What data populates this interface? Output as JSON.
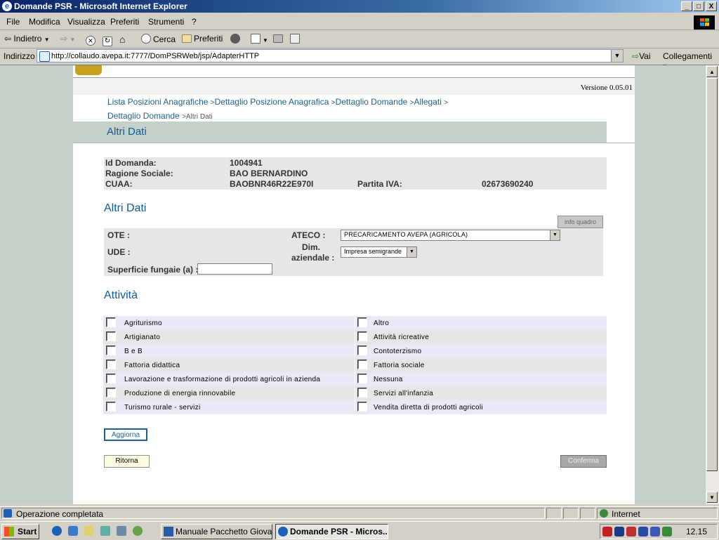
{
  "window": {
    "title": "Domande PSR - Microsoft Internet Explorer",
    "minimize_label": "_",
    "maximize_label": "□",
    "close_label": "X"
  },
  "menu": [
    "File",
    "Modifica",
    "Visualizza",
    "Preferiti",
    "Strumenti",
    "?"
  ],
  "toolbar": {
    "back_label": "Indietro",
    "search_label": "Cerca",
    "favorites_label": "Preferiti"
  },
  "address": {
    "label": "Indirizzo",
    "url": "http://collaudo.avepa.it:7777/DomPSRWeb/jsp/AdapterHTTP",
    "go_label": "Vai",
    "links_label": "Collegamenti"
  },
  "page": {
    "version": "Versione 0.05.01",
    "breadcrumb": [
      {
        "label": "Lista Posizioni Anagrafiche",
        "link": true
      },
      {
        "label": "Dettaglio Posizione Anagrafica",
        "link": true
      },
      {
        "label": "Dettaglio Domande",
        "link": true
      },
      {
        "label": "Allegati",
        "link": true
      },
      {
        "label": "Dettaglio Domande",
        "link": true
      },
      {
        "label": "Altri Dati",
        "link": false
      }
    ],
    "breadcrumb_sep": ">",
    "header_title": "Altri Dati",
    "summary": {
      "id_label": "Id Domanda:",
      "id_value": "1004941",
      "ragione_label": "Ragione Sociale:",
      "ragione_value": "BAO BERNARDINO",
      "cuaa_label": "CUAA:",
      "cuaa_value": "BAOBNR46R22E970I",
      "piva_label": "Partita IVA:",
      "piva_value": "02673690240"
    },
    "section1_title": "Altri Dati",
    "info_button": "info quadro",
    "form": {
      "ote_label": "OTE :",
      "ude_label": "UDE :",
      "ateco_label": "ATECO :",
      "ateco_value": "PRECARICAMENTO AVEPA (AGRICOLA)",
      "dim_label_1": "Dim.",
      "dim_label_2": "aziendale :",
      "dim_value": "Impresa semigrande",
      "superficie_label": "Superficie fungaie (a) :",
      "superficie_value": ""
    },
    "section2_title": "Attività",
    "activities": [
      {
        "left": "Agriturismo",
        "right": "Altro"
      },
      {
        "left": "Artigianato",
        "right": "Attività ricreative"
      },
      {
        "left": "B e B",
        "right": "Contoterzismo"
      },
      {
        "left": "Fattoria didattica",
        "right": "Fattoria sociale"
      },
      {
        "left": "Lavorazione e trasformazione di prodotti agricoli in azienda",
        "right": "Nessuna"
      },
      {
        "left": "Produzione di energia rinnovabile",
        "right": "Servizi all'infanzia"
      },
      {
        "left": "Turismo rurale - servizi",
        "right": "Vendita diretta di prodotti agricoli"
      }
    ],
    "aggiorna_button": "Aggiorna",
    "ritorna_button": "Ritorna",
    "conferma_button": "Conferma"
  },
  "status": {
    "text": "Operazione completata",
    "zone": "Internet"
  },
  "taskbar": {
    "start_label": "Start",
    "tasks": [
      {
        "label": "Manuale Pacchetto Giova...",
        "active": false
      },
      {
        "label": "Domande PSR - Micros...",
        "active": true
      }
    ],
    "clock": "12.15"
  },
  "colors": {
    "title_bar": "#0a246a",
    "link": "#1f5f8f",
    "section_title": "#0f5a98",
    "header_band": "#c5d0c8",
    "row_a": "#e8e8f6",
    "row_b": "#e6e6e6"
  }
}
